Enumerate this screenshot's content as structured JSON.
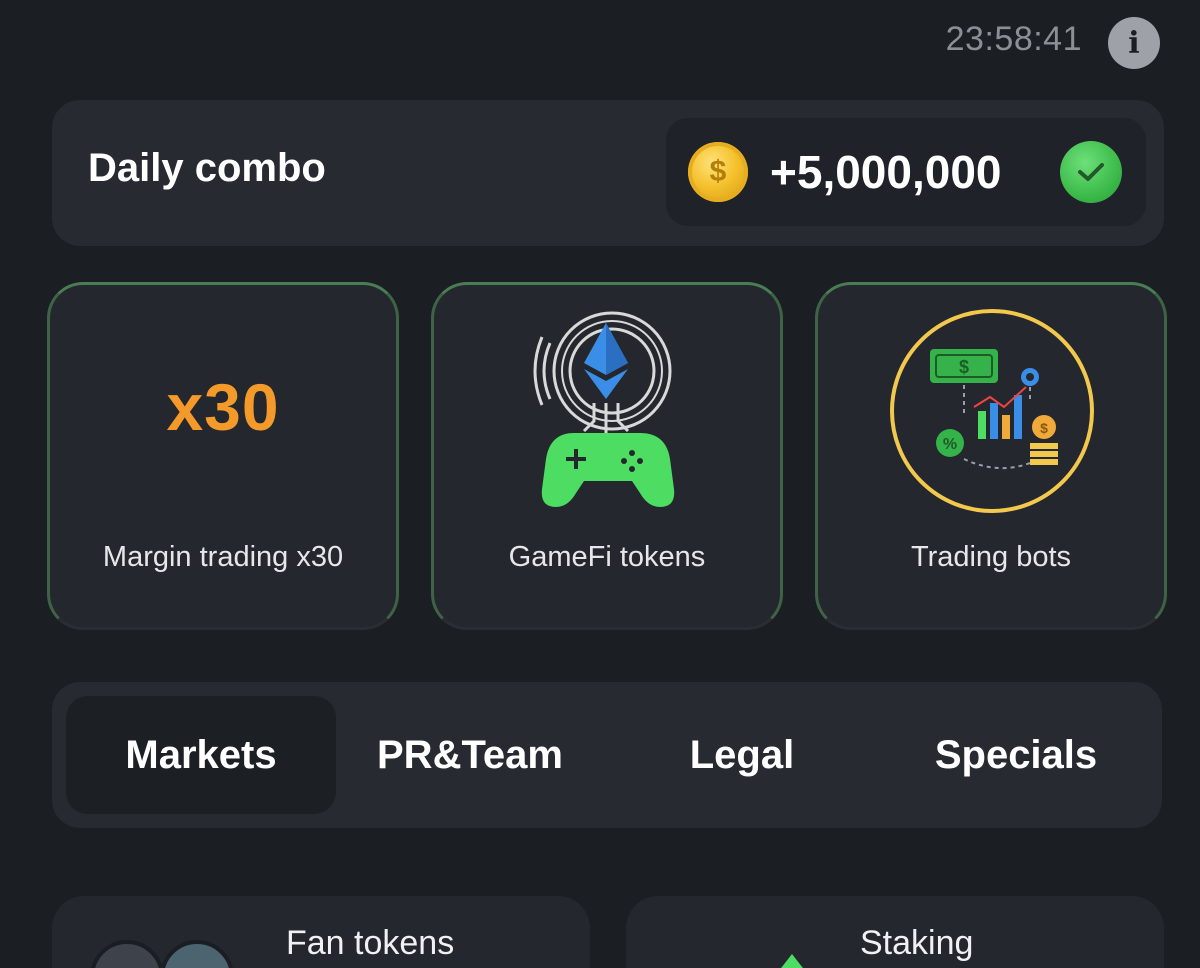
{
  "header": {
    "timer": "23:58:41",
    "info_icon": "info-icon"
  },
  "combo": {
    "title": "Daily combo",
    "reward": "+5,000,000",
    "coin_icon": "coin-icon",
    "status_icon": "check-circle-icon",
    "coin_symbol": "$"
  },
  "cards": [
    {
      "label": "Margin trading x30",
      "badge": "x30"
    },
    {
      "label": "GameFi tokens"
    },
    {
      "label": "Trading bots"
    }
  ],
  "tabs": [
    {
      "label": "Markets",
      "active": true
    },
    {
      "label": "PR&Team",
      "active": false
    },
    {
      "label": "Legal",
      "active": false
    },
    {
      "label": "Specials",
      "active": false
    }
  ],
  "bottom_cards": [
    {
      "label": "Fan tokens"
    },
    {
      "label": "Staking"
    }
  ],
  "colors": {
    "background": "#1b1e23",
    "panel": "#272a31",
    "accent_green": "#4ddd63",
    "accent_orange": "#f39a2a",
    "accent_blue": "#3b8ee8",
    "muted_text": "#8b8f96"
  }
}
